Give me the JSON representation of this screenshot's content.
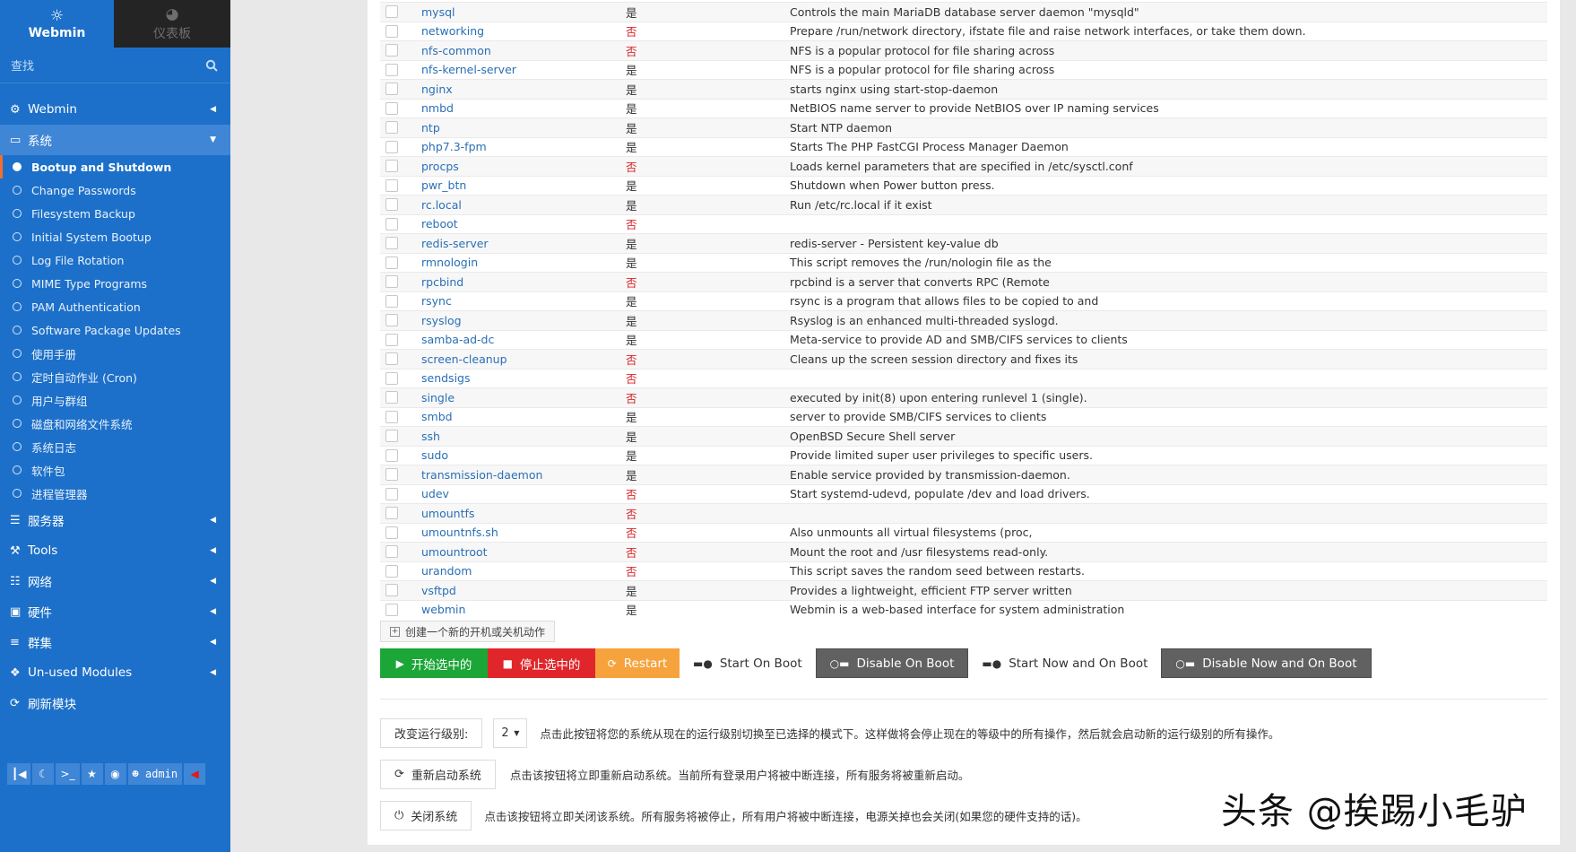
{
  "sidebar": {
    "brand": {
      "webmin_label": "Webmin",
      "dashboard_label": "仪表板"
    },
    "search": {
      "placeholder": "查找"
    },
    "categories_top": [
      {
        "label": "Webmin",
        "icon": "gear-icon"
      },
      {
        "label": "系统",
        "icon": "monitor-icon",
        "expanded": true
      }
    ],
    "system_items": [
      {
        "label": "Bootup and Shutdown",
        "active": true
      },
      {
        "label": "Change Passwords"
      },
      {
        "label": "Filesystem Backup"
      },
      {
        "label": "Initial System Bootup"
      },
      {
        "label": "Log File Rotation"
      },
      {
        "label": "MIME Type Programs"
      },
      {
        "label": "PAM Authentication"
      },
      {
        "label": "Software Package Updates"
      },
      {
        "label": "使用手册"
      },
      {
        "label": "定时自动作业 (Cron)"
      },
      {
        "label": "用户与群组"
      },
      {
        "label": "磁盘和网络文件系统"
      },
      {
        "label": "系统日志"
      },
      {
        "label": "软件包"
      },
      {
        "label": "进程管理器"
      }
    ],
    "categories_bottom": [
      {
        "label": "服务器",
        "icon": "server-icon"
      },
      {
        "label": "Tools",
        "icon": "wrench-icon"
      },
      {
        "label": "网络",
        "icon": "network-icon"
      },
      {
        "label": "硬件",
        "icon": "hardware-icon"
      },
      {
        "label": "群集",
        "icon": "cluster-icon"
      },
      {
        "label": "Un-used Modules",
        "icon": "puzzle-icon"
      },
      {
        "label": "刷新模块",
        "icon": "refresh-icon"
      }
    ],
    "bottom_bar": {
      "user": "admin"
    }
  },
  "services": [
    {
      "name": "mysql",
      "boot": "是",
      "desc": "Controls the main MariaDB database server daemon \"mysqld\""
    },
    {
      "name": "networking",
      "boot": "否",
      "desc": "Prepare /run/network directory, ifstate file and raise network interfaces, or take them down."
    },
    {
      "name": "nfs-common",
      "boot": "否",
      "desc": "NFS is a popular protocol for file sharing across"
    },
    {
      "name": "nfs-kernel-server",
      "boot": "是",
      "desc": "NFS is a popular protocol for file sharing across"
    },
    {
      "name": "nginx",
      "boot": "是",
      "desc": "starts nginx using start-stop-daemon"
    },
    {
      "name": "nmbd",
      "boot": "是",
      "desc": "NetBIOS name server to provide NetBIOS over IP naming services"
    },
    {
      "name": "ntp",
      "boot": "是",
      "desc": "Start NTP daemon"
    },
    {
      "name": "php7.3-fpm",
      "boot": "是",
      "desc": "Starts The PHP FastCGI Process Manager Daemon"
    },
    {
      "name": "procps",
      "boot": "否",
      "desc": "Loads kernel parameters that are specified in /etc/sysctl.conf"
    },
    {
      "name": "pwr_btn",
      "boot": "是",
      "desc": "Shutdown when Power button press."
    },
    {
      "name": "rc.local",
      "boot": "是",
      "desc": "Run /etc/rc.local if it exist"
    },
    {
      "name": "reboot",
      "boot": "否",
      "desc": ""
    },
    {
      "name": "redis-server",
      "boot": "是",
      "desc": "redis-server - Persistent key-value db"
    },
    {
      "name": "rmnologin",
      "boot": "是",
      "desc": "This script removes the /run/nologin file as the"
    },
    {
      "name": "rpcbind",
      "boot": "否",
      "desc": "rpcbind is a server that converts RPC (Remote"
    },
    {
      "name": "rsync",
      "boot": "是",
      "desc": "rsync is a program that allows files to be copied to and"
    },
    {
      "name": "rsyslog",
      "boot": "是",
      "desc": "Rsyslog is an enhanced multi-threaded syslogd."
    },
    {
      "name": "samba-ad-dc",
      "boot": "是",
      "desc": "Meta-service to provide AD and SMB/CIFS services to clients"
    },
    {
      "name": "screen-cleanup",
      "boot": "否",
      "desc": "Cleans up the screen session directory and fixes its"
    },
    {
      "name": "sendsigs",
      "boot": "否",
      "desc": ""
    },
    {
      "name": "single",
      "boot": "否",
      "desc": "executed by init(8) upon entering runlevel 1 (single)."
    },
    {
      "name": "smbd",
      "boot": "是",
      "desc": "server to provide SMB/CIFS services to clients"
    },
    {
      "name": "ssh",
      "boot": "是",
      "desc": "OpenBSD Secure Shell server"
    },
    {
      "name": "sudo",
      "boot": "是",
      "desc": "Provide limited super user privileges to specific users."
    },
    {
      "name": "transmission-daemon",
      "boot": "是",
      "desc": "Enable service provided by transmission-daemon."
    },
    {
      "name": "udev",
      "boot": "否",
      "desc": "Start systemd-udevd, populate /dev and load drivers."
    },
    {
      "name": "umountfs",
      "boot": "否",
      "desc": ""
    },
    {
      "name": "umountnfs.sh",
      "boot": "否",
      "desc": "Also unmounts all virtual filesystems (proc,"
    },
    {
      "name": "umountroot",
      "boot": "否",
      "desc": "Mount the root and /usr filesystems read-only."
    },
    {
      "name": "urandom",
      "boot": "否",
      "desc": "This script saves the random seed between restarts."
    },
    {
      "name": "vsftpd",
      "boot": "是",
      "desc": "Provides a lightweight, efficient FTP server written"
    },
    {
      "name": "webmin",
      "boot": "是",
      "desc": "Webmin is a web-based interface for system administration"
    }
  ],
  "create_link": "创建一个新的开机或关机动作",
  "actions": {
    "start": "开始选中的",
    "stop": "停止选中的",
    "restart": "Restart",
    "start_on_boot": "Start On Boot",
    "disable_on_boot": "Disable On Boot",
    "start_now_and_on_boot": "Start Now and On Boot",
    "disable_now_and_on_boot": "Disable Now and On Boot"
  },
  "runlevel": {
    "button": "改变运行级别:",
    "value": "2",
    "desc": "点击此按钮将您的系统从现在的运行级别切换至已选择的模式下。这样做将会停止现在的等级中的所有操作，然后就会启动新的运行级别的所有操作。"
  },
  "reboot": {
    "button": "重新启动系统",
    "desc": "点击该按钮将立即重新启动系统。当前所有登录用户将被中断连接，所有服务将被重新启动。"
  },
  "shutdown": {
    "button": "关闭系统",
    "desc": "点击该按钮将立即关闭该系统。所有服务将被停止，所有用户将被中断连接，电源关掉也会关闭(如果您的硬件支持的话)。"
  },
  "watermark": "头条 @挨踢小毛驴",
  "colors": {
    "sidebar": "#1d70c9",
    "green": "#1ba637",
    "red": "#e0262b",
    "orange": "#f6a33e",
    "dark": "#616161"
  }
}
